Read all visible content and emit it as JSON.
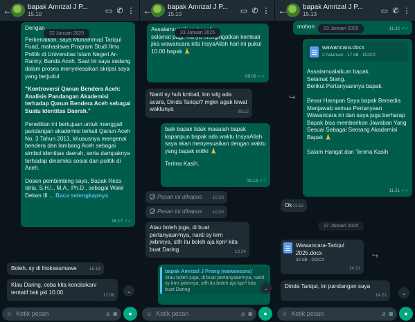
{
  "header": {
    "contact_name": "bapak Amrizal J Prang",
    "contact_short": "bapak Amrizal J P...",
    "s1_time": "15.10",
    "s2_time": "15.10",
    "s3_time": "15.13"
  },
  "footer": {
    "placeholder": "Ketik pesan"
  },
  "screen1": {
    "partial_greeting": "Dengan",
    "date_chip": "22 Januari 2025",
    "intro": "Perkenalkan, saya Muhammad Tariqul Fuad, mahasiswa Program Studi Ilmu Politik di Universitas Islam Negeri Ar-Raniry, Banda Aceh. Saat ini saya sedang dalam proses menyelesaikan skripsi saya yang berjudul:",
    "thesis_title": "\"Kontroversi Qanun Bendera Aceh: Analisis Pandangan Akademisi terhadap Qanun Bendera Aceh sebagai Suatu Identitas Daerah.\"",
    "purpose": "Penelitian ini bertujuan untuk menggali pandangan akademisi terkait Qanun Aceh No. 3 Tahun 2013, khususnya mengenai bendera dan lambang Aceh sebagai simbol identitas daerah, serta dampaknya terhadap dinamika sosial dan politik di Aceh.",
    "supervisor": "Dosen pembimbing saya, Bapak Reza Idria, S.H.I., M.A., Ph.D., sebagai Wakil Dekan III ...",
    "read_more": "Baca selengkapnya",
    "long_time": "16.17",
    "msg_lihat": "Boleh, sy di lhokseumawe",
    "msg_lihat_time": "16.18",
    "msg_daring": "Klau Daring, coba kita kondisikan/ tentatif bsk pkl 10.00",
    "msg_daring_time": "17.08"
  },
  "screen2": {
    "partial_greeting": "Assalamualaikum bapak.",
    "date_chip": "23 Januari 2025",
    "msg1": "selamat pagi, hanya mengingatkan kembali jika wawancara kita InsyaAllah hari ini pukul 10.00 bapak",
    "msg1_time": "09.09",
    "msg2": "Nanti sy hub kmbali, km sdg ada acara, Dinda Tariqul? mgkn agak lewat waktunya",
    "msg2_time": "09.12",
    "msg3": "baik bapak tidak masalah bapak kapanpun bapak ada waktu InsyaAllah saya akan menyesuaikan dengan waktu yang bapak miliki",
    "msg4": "Terima Kasih.",
    "msg4_time": "09.14",
    "deleted_text": "Pesan ini dihapus",
    "deleted1_time": "10.20",
    "deleted2_time": "10.20",
    "msg5": "Atau boleh juga, di buat pertanyaan²nya, nanti sy krm jwbnnya, stlh itu boleh aja kpn² kita buat Daring",
    "msg5_time": "13.24",
    "quote_name": "bapak Amrizal J Prang (wawancara)",
    "quote_text": "Atau boleh juga, di buat pertanyaan²nya, nanti sy krm jwbnnya, stlh itu boleh aja kpn² kita buat Daring"
  },
  "screen3": {
    "partial": "mohon",
    "date_chip": "23 Januari 2025",
    "partial_time": "11.32",
    "doc_name": "wawancara.docx",
    "doc_meta": "2 halaman · 17 kB · DOCX",
    "msg_assalam": "Assalamualaikum bapak.\nSelamat Siang.\nBerikut Pertanyaannya bapak.",
    "msg_harapan": "Besar Harapan Saya bapak Bersedia Menjawab semua Pertanyaan Wawancara ini dan saya juga berharap Bapak bisa memberikan Jawaban Yang Sesuai Sebagai Seorang Akademisi Bapak",
    "msg_salam": "Salam Hangat dan Terima Kasih",
    "msg_salam_time": "11.51",
    "msg_ok": "Ok",
    "msg_ok_time": "11.52",
    "date_chip2": "27 Januari 2025",
    "doc2_name": "Wawancara-Tariqul 2025.docx",
    "doc2_meta": "32 kB · DOCX",
    "doc2_time": "14.21",
    "msg_dinda": "Dinda Tariqul, ini pandangan saya",
    "msg_dinda_time": "14.22"
  }
}
